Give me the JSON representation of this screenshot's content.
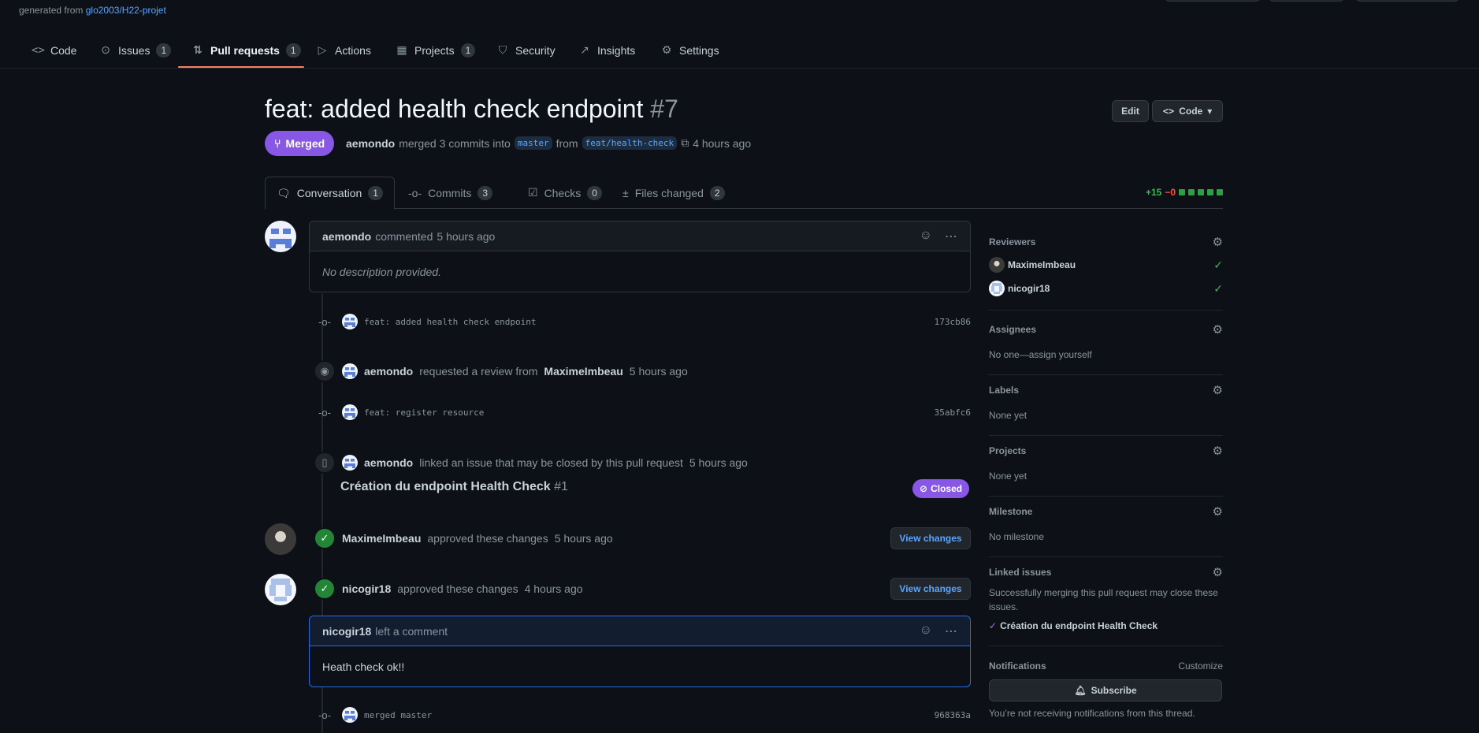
{
  "header": {
    "generated_prefix": "generated from",
    "template_repo": "glo2003/H22-projet"
  },
  "repo_nav": [
    {
      "label": "Code",
      "icon": "code-icon",
      "glyph": "<>",
      "count": null
    },
    {
      "label": "Issues",
      "icon": "issue-icon",
      "glyph": "⊙",
      "count": "1"
    },
    {
      "label": "Pull requests",
      "icon": "pull-request-icon",
      "glyph": "⇅",
      "count": "1",
      "selected": true
    },
    {
      "label": "Actions",
      "icon": "play-icon",
      "glyph": "▷",
      "count": null
    },
    {
      "label": "Projects",
      "icon": "table-icon",
      "glyph": "▦",
      "count": "1"
    },
    {
      "label": "Security",
      "icon": "shield-icon",
      "glyph": "⛉",
      "count": null
    },
    {
      "label": "Insights",
      "icon": "graph-icon",
      "glyph": "↗",
      "count": null
    },
    {
      "label": "Settings",
      "icon": "gear-icon",
      "glyph": "⚙",
      "count": null
    }
  ],
  "pr": {
    "title": "feat: added health check endpoint",
    "number": "#7",
    "state": "Merged",
    "author": "aemondo",
    "merge_text": "merged 3 commits into",
    "base_branch": "master",
    "from_text": "from",
    "head_branch": "feat/health-check",
    "time": "4 hours ago",
    "edit_label": "Edit",
    "code_label": "Code"
  },
  "tabs": [
    {
      "label": "Conversation",
      "count": "1",
      "icon": "comment-discussion-icon",
      "glyph": "🗨",
      "selected": true
    },
    {
      "label": "Commits",
      "count": "3",
      "icon": "commit-icon",
      "glyph": "-o-"
    },
    {
      "label": "Checks",
      "count": "0",
      "icon": "checklist-icon",
      "glyph": "☑"
    },
    {
      "label": "Files changed",
      "count": "2",
      "icon": "file-diff-icon",
      "glyph": "±"
    }
  ],
  "diffstat": {
    "additions": "+15",
    "deletions": "−0"
  },
  "timeline": {
    "first_comment": {
      "author": "aemondo",
      "action": "commented",
      "time": "5 hours ago",
      "body": "No description provided."
    },
    "commit1": {
      "message": "feat: added health check endpoint",
      "sha": "173cb86"
    },
    "review_request": {
      "actor": "aemondo",
      "text": "requested a review from",
      "target": "MaximeImbeau",
      "time": "5 hours ago"
    },
    "commit2": {
      "message": "feat: register resource",
      "sha": "35abfc6"
    },
    "linked_issue_event": {
      "actor": "aemondo",
      "text": "linked an issue that may be closed by this pull request",
      "time": "5 hours ago"
    },
    "linked_issue": {
      "title": "Création du endpoint Health Check",
      "number": "#1",
      "state": "Closed"
    },
    "approval1": {
      "actor": "MaximeImbeau",
      "text": "approved these changes",
      "time": "5 hours ago",
      "button": "View changes"
    },
    "approval2": {
      "actor": "nicogir18",
      "text": "approved these changes",
      "time": "4 hours ago",
      "button": "View changes"
    },
    "review_comment": {
      "author": "nicogir18",
      "action": "left a comment",
      "body": "Heath check ok!!"
    },
    "commit3": {
      "message": "merged master",
      "sha": "968363a"
    }
  },
  "sidebar": {
    "reviewers": {
      "title": "Reviewers",
      "items": [
        {
          "name": "MaximeImbeau"
        },
        {
          "name": "nicogir18"
        }
      ]
    },
    "assignees": {
      "title": "Assignees",
      "value": "No one—assign yourself"
    },
    "labels": {
      "title": "Labels",
      "value": "None yet"
    },
    "projects": {
      "title": "Projects",
      "value": "None yet"
    },
    "milestone": {
      "title": "Milestone",
      "value": "No milestone"
    },
    "linked_issues": {
      "title": "Linked issues",
      "value": "Successfully merging this pull request may close these issues.",
      "issue": "Création du endpoint Health Check"
    },
    "notifications": {
      "title": "Notifications",
      "customize": "Customize",
      "subscribe": "Subscribe",
      "status": "You’re not receiving notifications from this thread."
    }
  },
  "colors": {
    "accent_merged": "#8957e5",
    "success": "#238636",
    "link": "#58a6ff",
    "nav_underline": "#f78166"
  }
}
